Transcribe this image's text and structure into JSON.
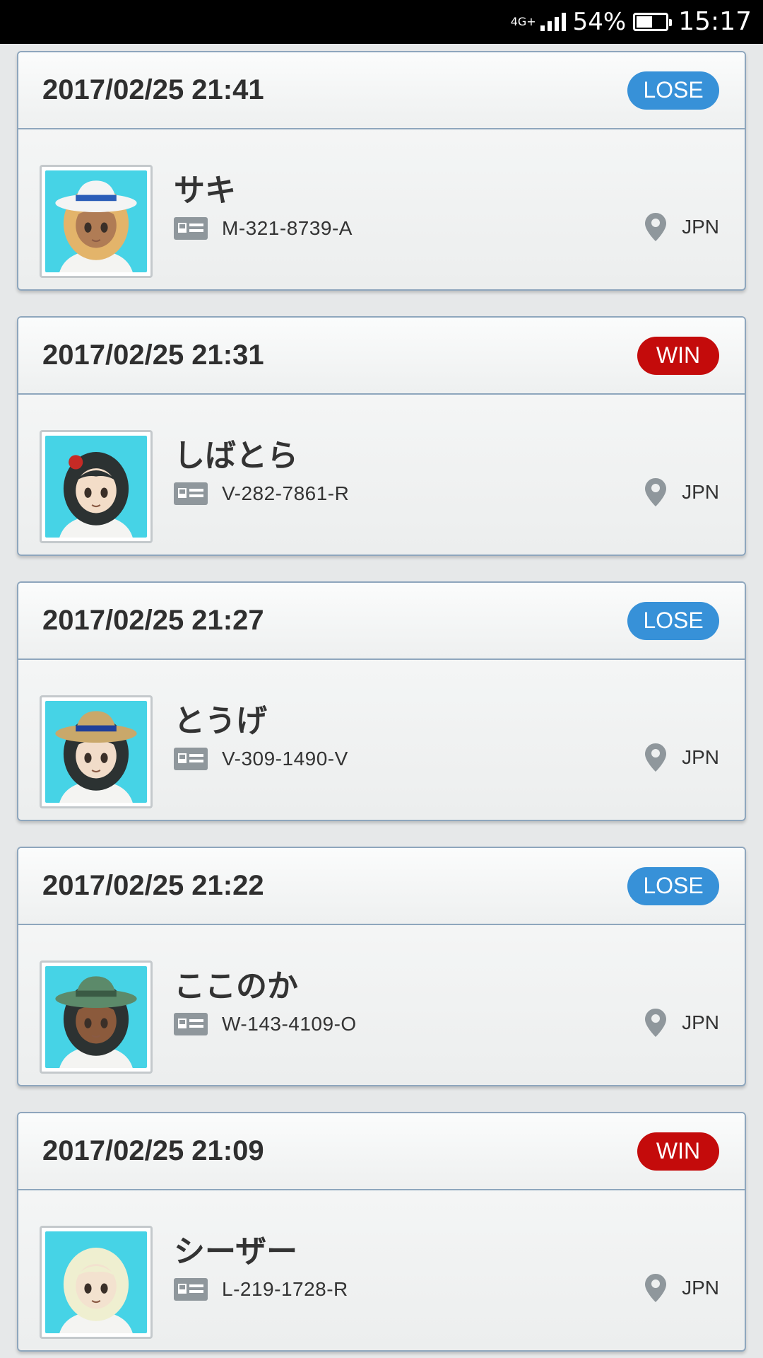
{
  "status_bar": {
    "network_type": "4G+",
    "battery_percent": "54%",
    "battery_level": 0.54,
    "time": "15:17"
  },
  "matches": [
    {
      "datetime": "2017/02/25 21:41",
      "result": "LOSE",
      "name": "サキ",
      "friend_code": "M-321-8739-A",
      "region": "JPN",
      "avatar": {
        "bg": "#46d3e6",
        "hair": "#e3b46a",
        "skin": "#b07c55",
        "hat": "#f4f4f4",
        "hat_band": "#2b5db8"
      }
    },
    {
      "datetime": "2017/02/25 21:31",
      "result": "WIN",
      "name": "しばとら",
      "friend_code": "V-282-7861-R",
      "region": "JPN",
      "avatar": {
        "bg": "#46d3e6",
        "hair": "#2c3232",
        "skin": "#f3ddc8",
        "hat": "",
        "hat_band": "#c62a25"
      }
    },
    {
      "datetime": "2017/02/25 21:27",
      "result": "LOSE",
      "name": "とうげ",
      "friend_code": "V-309-1490-V",
      "region": "JPN",
      "avatar": {
        "bg": "#46d3e6",
        "hair": "#2c3232",
        "skin": "#f1dcc9",
        "hat": "#c9a86a",
        "hat_band": "#1f3f9a"
      }
    },
    {
      "datetime": "2017/02/25 21:22",
      "result": "LOSE",
      "name": "ここのか",
      "friend_code": "W-143-4109-O",
      "region": "JPN",
      "avatar": {
        "bg": "#46d3e6",
        "hair": "#2c3232",
        "skin": "#8b5a3c",
        "hat": "#5c8a6a",
        "hat_band": "#3a5a44"
      }
    },
    {
      "datetime": "2017/02/25 21:09",
      "result": "WIN",
      "name": "シーザー",
      "friend_code": "L-219-1728-R",
      "region": "JPN",
      "avatar": {
        "bg": "#46d3e6",
        "hair": "#efefd0",
        "skin": "#f3e2cf",
        "hat": "",
        "hat_band": ""
      }
    }
  ]
}
